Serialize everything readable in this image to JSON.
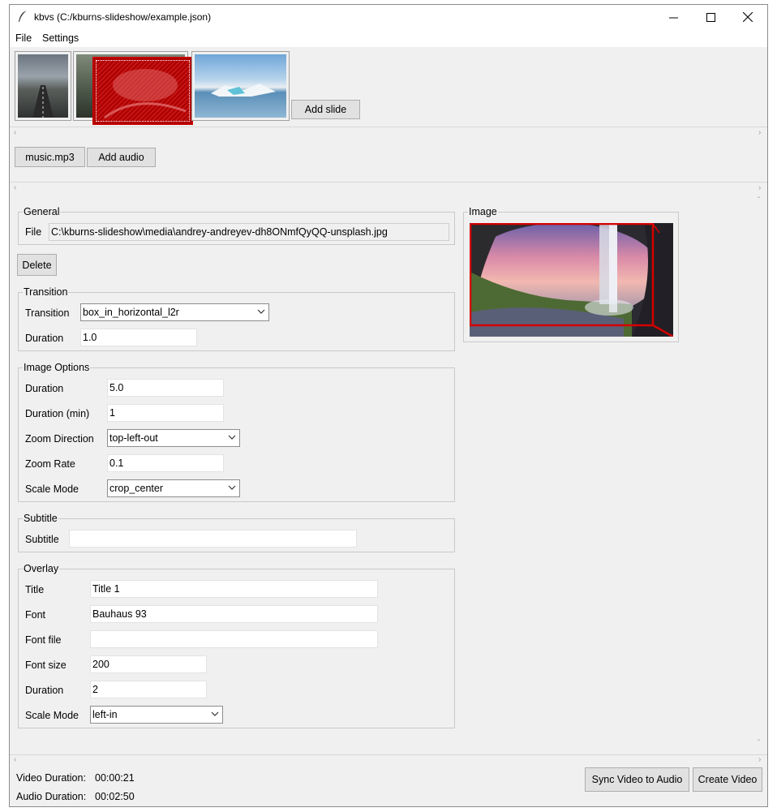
{
  "window": {
    "title": "kbvs (C:/kburns-slideshow/example.json)"
  },
  "menu": {
    "file": "File",
    "settings": "Settings"
  },
  "slides": {
    "add_slide_label": "Add slide"
  },
  "audio": {
    "track_label": "music.mp3",
    "add_audio_label": "Add audio"
  },
  "general": {
    "group_label": "General",
    "file_label": "File",
    "file_value": "C:\\kburns-slideshow\\media\\andrey-andreyev-dh8ONmfQyQQ-unsplash.jpg"
  },
  "delete_label": "Delete",
  "transition": {
    "group_label": "Transition",
    "transition_label": "Transition",
    "transition_value": "box_in_horizontal_l2r",
    "duration_label": "Duration",
    "duration_value": "1.0"
  },
  "image_options": {
    "group_label": "Image Options",
    "duration_label": "Duration",
    "duration_value": "5.0",
    "duration_min_label": "Duration (min)",
    "duration_min_value": "1",
    "zoom_direction_label": "Zoom Direction",
    "zoom_direction_value": "top-left-out",
    "zoom_rate_label": "Zoom Rate",
    "zoom_rate_value": "0.1",
    "scale_mode_label": "Scale Mode",
    "scale_mode_value": "crop_center"
  },
  "subtitle": {
    "group_label": "Subtitle",
    "subtitle_label": "Subtitle",
    "subtitle_value": ""
  },
  "overlay": {
    "group_label": "Overlay",
    "title_label": "Title",
    "title_value": "Title 1",
    "font_label": "Font",
    "font_value": "Bauhaus 93",
    "font_file_label": "Font file",
    "font_file_value": "",
    "font_size_label": "Font size",
    "font_size_value": "200",
    "duration_label": "Duration",
    "duration_value": "2",
    "scale_mode_label": "Scale Mode",
    "scale_mode_value": "left-in"
  },
  "image_panel": {
    "group_label": "Image"
  },
  "status": {
    "video_duration_label": "Video Duration:",
    "video_duration_value": "00:00:21",
    "audio_duration_label": "Audio Duration:",
    "audio_duration_value": "00:02:50"
  },
  "actions": {
    "sync_label": "Sync Video to Audio",
    "create_label": "Create Video"
  },
  "colors": {
    "selection_red": "#cc0000",
    "window_bg": "#f0f0f0",
    "accent_border": "#d40000"
  }
}
